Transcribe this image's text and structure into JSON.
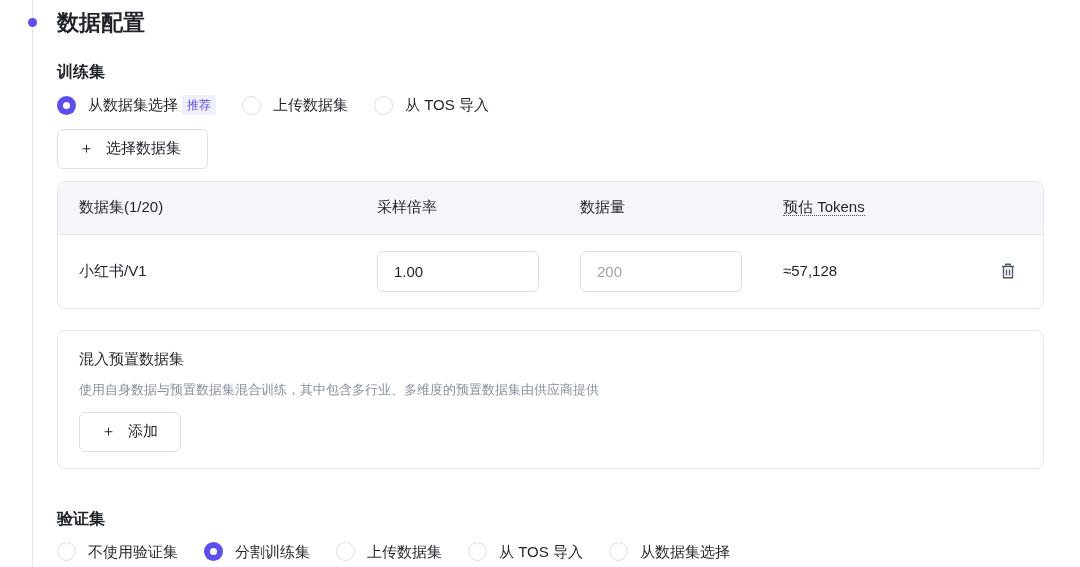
{
  "section_title": "数据配置",
  "training": {
    "label": "训练集",
    "options": [
      {
        "label": "从数据集选择",
        "selected": true,
        "badge": "推荐"
      },
      {
        "label": "上传数据集",
        "selected": false
      },
      {
        "label": "从 TOS 导入",
        "selected": false
      }
    ],
    "add_button": {
      "icon": "＋",
      "label": "选择数据集"
    },
    "table": {
      "columns": [
        {
          "label": "数据集(1/20)",
          "dotted": false
        },
        {
          "label": "采样倍率",
          "dotted": false
        },
        {
          "label": "数据量",
          "dotted": false
        },
        {
          "label": "预估 Tokens",
          "dotted": true
        }
      ],
      "rows": [
        {
          "name": "小红书/V1",
          "rate": "1.00",
          "amount_placeholder": "200",
          "tokens": "≈57,128"
        }
      ]
    }
  },
  "mix": {
    "title": "混入预置数据集",
    "description": "使用自身数据与预置数据集混合训练，其中包含多行业、多维度的预置数据集由供应商提供",
    "add_button": {
      "icon": "＋",
      "label": "添加"
    }
  },
  "validation": {
    "label": "验证集",
    "options": [
      {
        "label": "不使用验证集",
        "selected": false
      },
      {
        "label": "分割训练集",
        "selected": true
      },
      {
        "label": "上传数据集",
        "selected": false
      },
      {
        "label": "从 TOS 导入",
        "selected": false
      },
      {
        "label": "从数据集选择",
        "selected": false
      }
    ]
  }
}
